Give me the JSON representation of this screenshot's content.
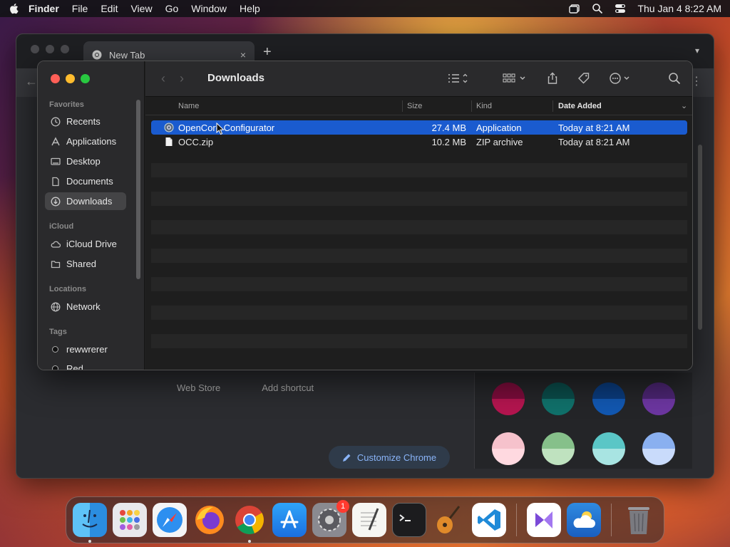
{
  "menubar": {
    "app_name": "Finder",
    "items": [
      "File",
      "Edit",
      "View",
      "Go",
      "Window",
      "Help"
    ],
    "clock": "Thu Jan 4  8:22 AM"
  },
  "chrome": {
    "tab_title": "New Tab",
    "tab_close": "×",
    "new_tab": "+",
    "shortcut_web_store": "Web Store",
    "shortcut_add": "Add shortcut",
    "customize_label": "Customize Chrome",
    "swatches": [
      {
        "top": "#7a0c3a",
        "bottom": "#b3154f"
      },
      {
        "top": "#0a4a48",
        "bottom": "#10706a"
      },
      {
        "top": "#0a3a7a",
        "bottom": "#1257b0"
      },
      {
        "top": "#4a2470",
        "bottom": "#6c36a0"
      },
      {
        "top": "#f6c2cc",
        "bottom": "#ffd9e0"
      },
      {
        "top": "#86c08a",
        "bottom": "#bfe2bf"
      },
      {
        "top": "#5ac6c6",
        "bottom": "#a8e4e2"
      },
      {
        "top": "#8ab0f0",
        "bottom": "#c9dbfb"
      }
    ]
  },
  "finder": {
    "title": "Downloads",
    "sidebar": {
      "favorites_heading": "Favorites",
      "favorites": [
        "Recents",
        "Applications",
        "Desktop",
        "Documents",
        "Downloads"
      ],
      "icloud_heading": "iCloud",
      "icloud": [
        "iCloud Drive",
        "Shared"
      ],
      "locations_heading": "Locations",
      "locations": [
        "Network"
      ],
      "tags_heading": "Tags",
      "tags": [
        "rewwrerer",
        "Red"
      ]
    },
    "columns": {
      "name": "Name",
      "size": "Size",
      "kind": "Kind",
      "date": "Date Added"
    },
    "files": [
      {
        "name": "OpenCore Configurator",
        "size": "27.4 MB",
        "kind": "Application",
        "date": "Today at 8:21 AM"
      },
      {
        "name": "OCC.zip",
        "size": "10.2 MB",
        "kind": "ZIP archive",
        "date": "Today at 8:21 AM"
      }
    ]
  },
  "dock": {
    "badge_system_settings": "1"
  },
  "colors": {
    "selection": "#1a5bcf",
    "close": "#ff5f57",
    "minimize": "#febc2e",
    "zoom": "#28c840"
  }
}
